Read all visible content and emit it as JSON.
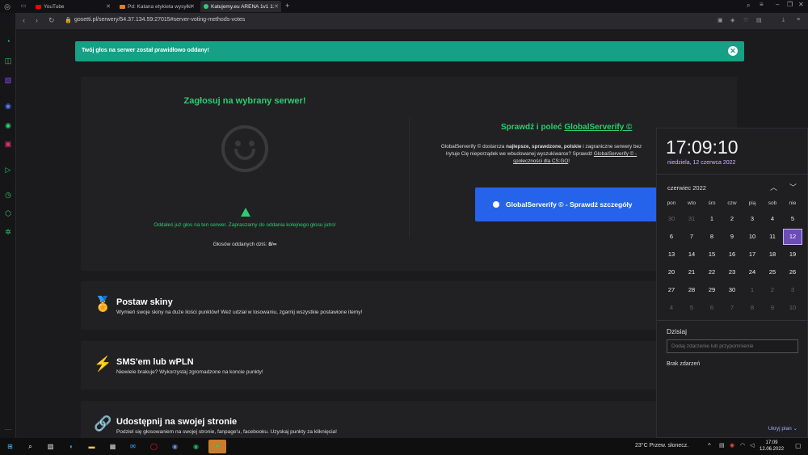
{
  "browser": {
    "tabs": [
      {
        "label": "YouTube",
        "color": "#ff0000"
      },
      {
        "label": "Pd: Katana etykieta wysyłki",
        "color": "#e0802a"
      },
      {
        "label": "Katujemy.eu ARENA 1v1 1:",
        "color": "#2ecc71"
      }
    ],
    "new_tab": "+",
    "url": "gosetti.pl/serwery/54.37.134.59:27015#server-voting-methods-votes"
  },
  "toast": {
    "message": "Twój głos na serwer został prawidłowo oddany!",
    "close": "✕"
  },
  "vote": {
    "title": "Zagłosuj na wybrany serwer!",
    "warning": "Oddałeś już głos na ten serwer. Zapraszamy do oddania kolejnego głosu jutro!",
    "count_label": "Głosów oddanych dziś: ",
    "count_value": "8/∞"
  },
  "globalserverify": {
    "title_prefix": "Sprawdź i poleć ",
    "title_link": "GlobalServerify ©",
    "desc_1": "GlobalServerify © dostarcza ",
    "desc_bold": "najlepsze, sprawdzone, polskie",
    "desc_2": " i zagraniczne serwery bez",
    "desc_3": "Irytuje Cię nieporządek we wbudowanej wyszukiwarce? Sprawdź ",
    "desc_link": "GlobalServerify © -",
    "desc_link2": "społeczności dla CS:GO",
    "desc_end": "!",
    "button": "GlobalServerify © - Sprawdź szczegóły"
  },
  "features": [
    {
      "icon": "award-icon",
      "title": "Postaw skiny",
      "desc": "Wymień swoje skiny na duże ilości punktów! Weź udział w losowaniu, zgarnij wszystkie postawione itemy!"
    },
    {
      "icon": "bolt-icon",
      "title": "SMS'em lub wPLN",
      "desc": "Niewiele brakuje? Wykorzystaj zgromadzone na koncie punkty!"
    },
    {
      "icon": "link-icon",
      "title": "Udostępnij na swojej stronie",
      "desc": "Podziel się głosowaniem na swojej stronie, fanpage'u, facebooku. Uzyskaj punkty za kliknięcia!"
    }
  ],
  "calendar": {
    "time": "17:09:10",
    "date_long": "niedziela, 12 czerwca 2022",
    "month": "czerwiec 2022",
    "weekdays": [
      "pon",
      "wto",
      "śro",
      "czw",
      "pią",
      "sob",
      "nie"
    ],
    "weeks": [
      [
        "30",
        "31",
        "1",
        "2",
        "3",
        "4",
        "5"
      ],
      [
        "6",
        "7",
        "8",
        "9",
        "10",
        "11",
        "12"
      ],
      [
        "13",
        "14",
        "15",
        "16",
        "17",
        "18",
        "19"
      ],
      [
        "20",
        "21",
        "22",
        "23",
        "24",
        "25",
        "26"
      ],
      [
        "27",
        "28",
        "29",
        "30",
        "1",
        "2",
        "3"
      ],
      [
        "4",
        "5",
        "6",
        "7",
        "8",
        "9",
        "10"
      ]
    ],
    "today_label": "Dzisiaj",
    "event_placeholder": "Dodaj zdarzenie lub przypomnienie",
    "no_events": "Brak zdarzeń",
    "hide_plan": "Ukryj plan"
  },
  "taskbar": {
    "weather": "23°C  Przew. słonecz.",
    "time": "17:09",
    "date": "12.06.2022"
  }
}
